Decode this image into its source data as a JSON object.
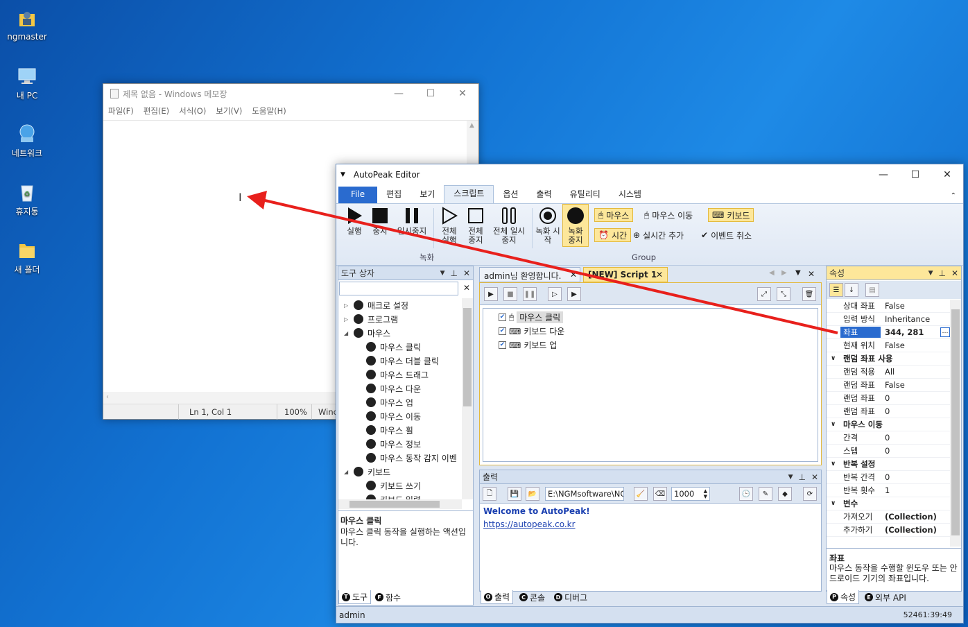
{
  "desktop": {
    "icons": [
      {
        "label": "ngmaster",
        "icon": "user-folder-icon"
      },
      {
        "label": "내 PC",
        "icon": "computer-icon"
      },
      {
        "label": "네트워크",
        "icon": "network-icon"
      },
      {
        "label": "휴지통",
        "icon": "recycle-bin-icon"
      },
      {
        "label": "새 폴더",
        "icon": "folder-icon"
      }
    ]
  },
  "notepad": {
    "title": "제목 없음 - Windows 메모장",
    "menu": [
      "파일(F)",
      "편집(E)",
      "서식(O)",
      "보기(V)",
      "도움말(H)"
    ],
    "status": {
      "position": "Ln 1, Col 1",
      "zoom": "100%",
      "encoding": "Winc"
    }
  },
  "autopeak": {
    "title": "AutoPeak Editor",
    "tabs": [
      "File",
      "편집",
      "보기",
      "스크립트",
      "옵션",
      "출력",
      "유틸리티",
      "시스템"
    ],
    "active_tab": "스크립트",
    "ribbon": {
      "record_group": "녹화",
      "group_group": "Group",
      "buttons": {
        "run": "실행",
        "stop": "중지",
        "pause": "일시중지",
        "run_all": "전체 실행",
        "stop_all": "전체 중지",
        "pause_all": "전체 일시중지",
        "rec_start": "녹화 시작",
        "rec_stop": "녹화 중지"
      },
      "small": {
        "mouse": "마우스",
        "mouse_move": "마우스 이동",
        "keyboard": "키보드",
        "time": "시간",
        "realtime_add": "실시간 추가",
        "event_cancel": "이벤트 취소"
      }
    },
    "toolbox": {
      "title": "도구 상자",
      "tree": [
        {
          "label": "매크로 설정",
          "level": 0,
          "expander": "▷"
        },
        {
          "label": "프로그램",
          "level": 0,
          "expander": "▷"
        },
        {
          "label": "마우스",
          "level": 0,
          "expander": "◢"
        },
        {
          "label": "마우스 클릭",
          "level": 1
        },
        {
          "label": "마우스 더블 클릭",
          "level": 1
        },
        {
          "label": "마우스 드래그",
          "level": 1
        },
        {
          "label": "마우스 다운",
          "level": 1
        },
        {
          "label": "마우스 업",
          "level": 1
        },
        {
          "label": "마우스 이동",
          "level": 1
        },
        {
          "label": "마우스 휠",
          "level": 1
        },
        {
          "label": "마우스 정보",
          "level": 1
        },
        {
          "label": "마우스 동작 감지 이벤",
          "level": 1
        },
        {
          "label": "키보드",
          "level": 0,
          "expander": "◢"
        },
        {
          "label": "키보드 쓰기",
          "level": 1
        },
        {
          "label": "키보드 입력",
          "level": 1
        }
      ],
      "desc_title": "마우스 클릭",
      "desc_text": "마우스 클릭 동작을 실행하는 액션입니다.",
      "bottom_tabs": [
        "도구",
        "함수"
      ]
    },
    "editor": {
      "tabs": [
        "admin님 환영합니다.",
        "[NEW] Script 1"
      ],
      "script_items": [
        "마우스 클릭",
        "키보드 다운",
        "키보드 업"
      ]
    },
    "output": {
      "title": "출력",
      "path": "E:\\NGMsoftware\\NG",
      "delay": "1000",
      "welcome": "Welcome to AutoPeak!",
      "link": "https://autopeak.co.kr",
      "bottom_tabs": [
        "출력",
        "콘솔",
        "디버그"
      ]
    },
    "properties": {
      "title": "속성",
      "rows": [
        {
          "type": "prop",
          "key": "상대 좌표",
          "value": "False"
        },
        {
          "type": "prop",
          "key": "입력 방식",
          "value": "Inheritance"
        },
        {
          "type": "prop",
          "key": "좌표",
          "value": "344, 281",
          "selected": true
        },
        {
          "type": "prop",
          "key": "현재 위치",
          "value": "False"
        },
        {
          "type": "cat",
          "key": "랜덤 좌표 사용"
        },
        {
          "type": "prop",
          "key": "랜덤 적용",
          "value": "All"
        },
        {
          "type": "prop",
          "key": "랜덤 좌표",
          "value": "False"
        },
        {
          "type": "prop",
          "key": "랜덤 좌표",
          "value": "0"
        },
        {
          "type": "prop",
          "key": "랜덤 좌표",
          "value": "0"
        },
        {
          "type": "cat",
          "key": "마우스 이동"
        },
        {
          "type": "prop",
          "key": "간격",
          "value": "0"
        },
        {
          "type": "prop",
          "key": "스텝",
          "value": "0"
        },
        {
          "type": "cat",
          "key": "반복 설정"
        },
        {
          "type": "prop",
          "key": "반복 간격",
          "value": "0"
        },
        {
          "type": "prop",
          "key": "반복 횟수",
          "value": "1"
        },
        {
          "type": "cat",
          "key": "변수"
        },
        {
          "type": "prop",
          "key": "가져오기",
          "value": "(Collection)"
        },
        {
          "type": "prop",
          "key": "추가하기",
          "value": "(Collection)"
        }
      ],
      "desc_title": "좌표",
      "desc_text": "마우스 동작을 수행할 윈도우 또는 안드로이드 기기의 좌표입니다.",
      "bottom_tabs": [
        "속성",
        "외부 API"
      ]
    },
    "status": {
      "user": "admin",
      "time": "52461:39:49"
    }
  },
  "colors": {
    "accent": "#2a6bcf",
    "highlight": "#fde79a",
    "arrow": "#e8201c"
  }
}
